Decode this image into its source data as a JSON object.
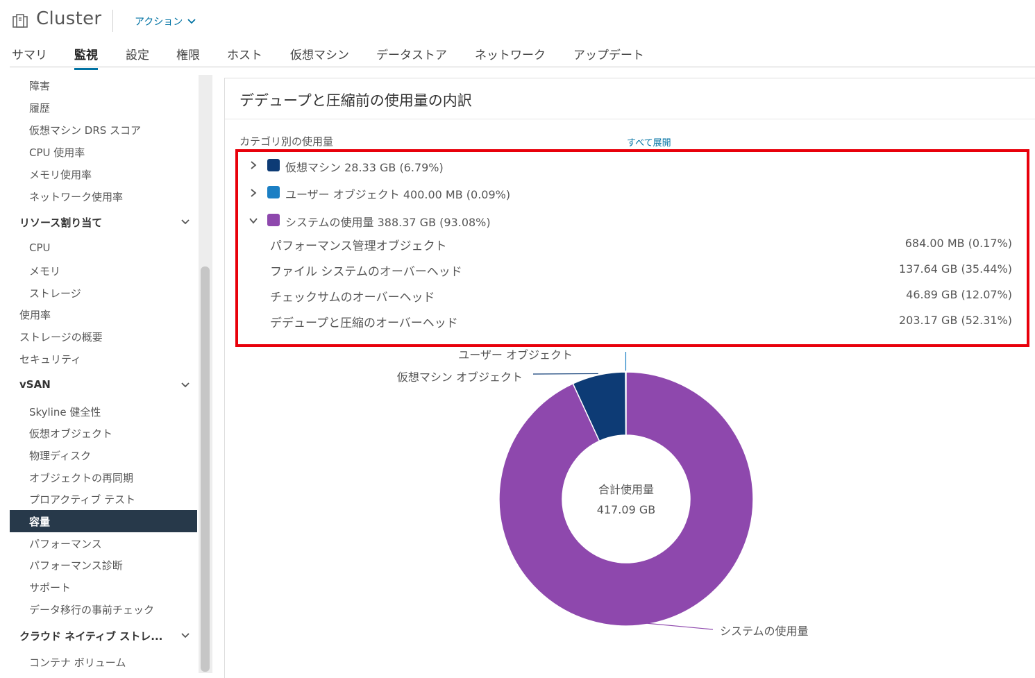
{
  "header": {
    "title": "Cluster",
    "actions_label": "アクション"
  },
  "tabs": [
    {
      "label": "サマリ"
    },
    {
      "label": "監視"
    },
    {
      "label": "設定"
    },
    {
      "label": "権限"
    },
    {
      "label": "ホスト"
    },
    {
      "label": "仮想マシン"
    },
    {
      "label": "データストア"
    },
    {
      "label": "ネットワーク"
    },
    {
      "label": "アップデート"
    }
  ],
  "active_tab": "監視",
  "sidebar": {
    "items": [
      {
        "label": "障害"
      },
      {
        "label": "履歴"
      },
      {
        "label": "仮想マシン DRS スコア"
      },
      {
        "label": "CPU 使用率"
      },
      {
        "label": "メモリ使用率"
      },
      {
        "label": "ネットワーク使用率"
      }
    ],
    "resource_section": "リソース割り当て",
    "resource_items": [
      {
        "label": "CPU"
      },
      {
        "label": "メモリ"
      },
      {
        "label": "ストレージ"
      }
    ],
    "top_items": [
      {
        "label": "使用率"
      },
      {
        "label": "ストレージの概要"
      },
      {
        "label": "セキュリティ"
      }
    ],
    "vsan_section": "vSAN",
    "vsan_items": [
      {
        "label": "Skyline 健全性"
      },
      {
        "label": "仮想オブジェクト"
      },
      {
        "label": "物理ディスク"
      },
      {
        "label": "オブジェクトの再同期"
      },
      {
        "label": "プロアクティブ テスト"
      },
      {
        "label": "容量"
      },
      {
        "label": "パフォーマンス"
      },
      {
        "label": "パフォーマンス診断"
      },
      {
        "label": "サポート"
      },
      {
        "label": "データ移行の事前チェック"
      }
    ],
    "cloud_section": "クラウド ネイティブ ストレ...",
    "cloud_items": [
      {
        "label": "コンテナ ボリューム"
      }
    ]
  },
  "panel": {
    "title": "デデュープと圧縮前の使用量の内訳",
    "category_label": "カテゴリ別の使用量",
    "expand_all": "すべて展開",
    "categories": [
      {
        "label": "仮想マシン 28.33 GB (6.79%)",
        "color": "#0d3b75",
        "expanded": false
      },
      {
        "label": "ユーザー オブジェクト 400.00 MB (0.09%)",
        "color": "#1b7fc4",
        "expanded": false
      },
      {
        "label": "システムの使用量 388.37 GB (93.08%)",
        "color": "#8e48ad",
        "expanded": true
      }
    ],
    "system_breakdown": [
      {
        "name": "パフォーマンス管理オブジェクト",
        "value": "684.00 MB (0.17%)"
      },
      {
        "name": "ファイル システムのオーバーヘッド",
        "value": "137.64 GB (35.44%)"
      },
      {
        "name": "チェックサムのオーバーヘッド",
        "value": "46.89 GB (12.07%)"
      },
      {
        "name": "デデュープと圧縮のオーバーヘッド",
        "value": "203.17 GB (52.31%)"
      }
    ]
  },
  "chart_data": {
    "type": "pie",
    "center_label": "合計使用量",
    "center_value": "417.09 GB",
    "slices": [
      {
        "label": "ユーザー オブジェクト",
        "value": 0.09,
        "color": "#1b7fc4"
      },
      {
        "label": "仮想マシン オブジェクト",
        "value": 6.79,
        "color": "#0d3b75"
      },
      {
        "label": "システムの使用量",
        "value": 93.08,
        "color": "#8e48ad"
      }
    ]
  }
}
